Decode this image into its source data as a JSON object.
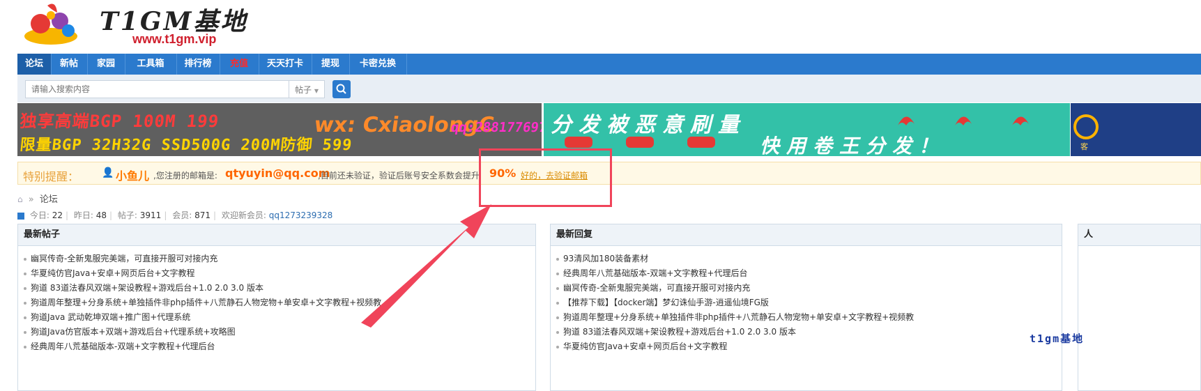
{
  "site": {
    "logo_text": "T1GM基地",
    "logo_url": "www.t1gm.vip"
  },
  "nav": [
    {
      "label": "论坛",
      "active": true
    },
    {
      "label": "新帖"
    },
    {
      "label": "家园"
    },
    {
      "label": "工具箱"
    },
    {
      "label": "排行榜"
    },
    {
      "label": "充值",
      "color": "#ff2a2a"
    },
    {
      "label": "天天打卡"
    },
    {
      "label": "提现"
    },
    {
      "label": "卡密兑换"
    }
  ],
  "search": {
    "placeholder": "请输入搜索内容",
    "type_label": "帖子",
    "button_icon": "search-icon"
  },
  "banners": {
    "left": {
      "line1": "独享高端BGP 100M  199",
      "line2": "限量BGP 32H32G SSD500G 200M防御 599",
      "wechat": "wx: CxiaolongC",
      "qq": "qq:2881776972"
    },
    "right": {
      "line1": "分发被恶意刷量",
      "line2": "快用卷王分发！"
    },
    "far_right": {
      "text": "客"
    }
  },
  "notice": {
    "title": "特别提醒：",
    "user": "小鱼儿",
    "text1": ",您注册的邮箱是:",
    "email": "qtyuyin@qq.com",
    "text2": ",目前还未验证，验证后账号安全系数会提升",
    "percent": "90%",
    "link": "好的，去验证邮箱"
  },
  "breadcrumb": {
    "home_icon": "home-icon",
    "sep": "»",
    "current": "论坛"
  },
  "stats": {
    "today_label": "今日:",
    "today": "22",
    "yesterday_label": "昨日:",
    "yesterday": "48",
    "posts_label": "帖子:",
    "posts": "3911",
    "members_label": "会员:",
    "members": "871",
    "welcome_label": "欢迎新会员:",
    "new_member": "qq1273239328"
  },
  "latest_posts": {
    "title": "最新帖子",
    "items": [
      "幽冥传奇-全新鬼服完美端，可直接开服可对接内充",
      "华夏纯仿官Java+安卓+网页后台+文字教程",
      "狗道 83道法春风双端+架设教程+游戏后台+1.0 2.0 3.0 版本",
      "狗道周年整理+分身系统+单独插件非php插件+八荒静石人物宠物+单安卓+文字教程+视频教",
      "狗道Java 武动乾坤双端+推广图+代理系统",
      "狗道Java仿官版本+双端+游戏后台+代理系统+攻略图",
      "经典周年八荒基础版本-双端+文字教程+代理后台"
    ]
  },
  "latest_replies": {
    "title": "最新回复",
    "items": [
      "93清风加180装备素材",
      "经典周年八荒基础版本-双端+文字教程+代理后台",
      "幽冥传奇-全新鬼服完美端，可直接开服可对接内充",
      "【推荐下载】【docker端】梦幻诛仙手游-逍遥仙境FG版",
      "狗道周年整理+分身系统+单独插件非php插件+八荒静石人物宠物+单安卓+文字教程+视频教",
      "狗道 83道法春风双端+架设教程+游戏后台+1.0 2.0 3.0 版本",
      "华夏纯仿官Java+安卓+网页后台+文字教程"
    ]
  },
  "third_panel": {
    "title": "人"
  },
  "watermark": "t1gm基地"
}
